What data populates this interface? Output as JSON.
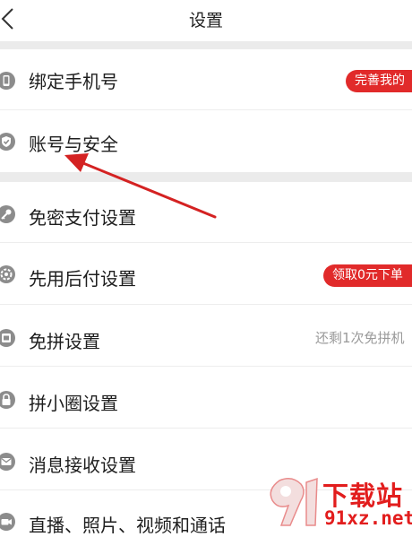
{
  "header": {
    "title": "设置"
  },
  "settings": [
    {
      "label": "绑定手机号",
      "icon": "phone-icon",
      "badge": "完善我的"
    },
    {
      "label": "账号与安全",
      "icon": "shield-icon"
    },
    {
      "label": "免密支付设置",
      "icon": "key-icon"
    },
    {
      "label": "先用后付设置",
      "icon": "gear-badge-icon",
      "badge": "领取0元下单"
    },
    {
      "label": "免拼设置",
      "icon": "card-icon",
      "hint": "还剩1次免拼机"
    },
    {
      "label": "拼小圈设置",
      "icon": "lock-icon"
    },
    {
      "label": "消息接收设置",
      "icon": "mail-icon"
    },
    {
      "label": "直播、照片、视频和通话",
      "icon": "camera-icon"
    }
  ],
  "watermark": {
    "top_text": "下载站",
    "bottom_text": "91xz.net"
  },
  "colors": {
    "badge": "#e12a2a",
    "arrow": "#d42222",
    "icon": "#8c8c8c",
    "separator": "#ebebeb"
  }
}
